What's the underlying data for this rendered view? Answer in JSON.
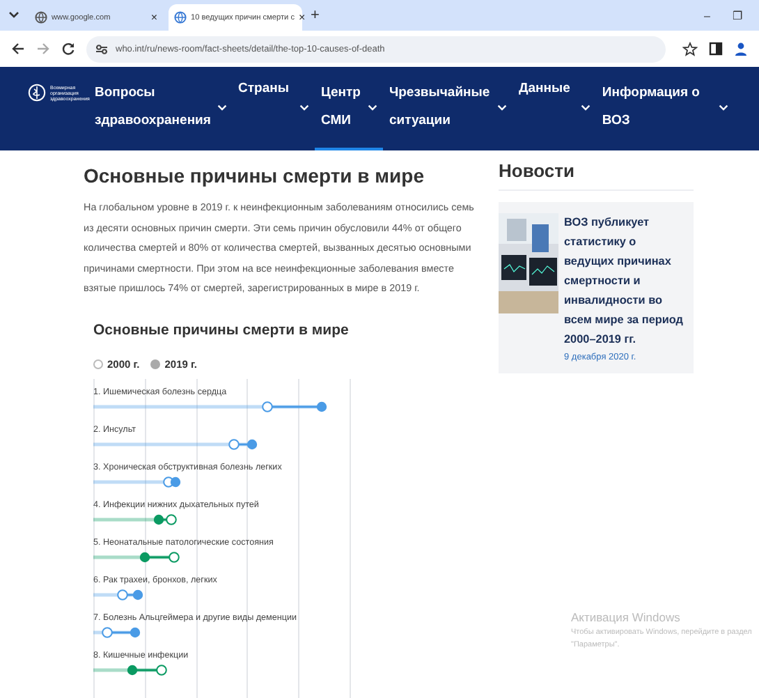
{
  "browser": {
    "tabs": [
      {
        "title": "www.google.com",
        "close": "×",
        "selected": false
      },
      {
        "title": "10 ведущих причин смерти с",
        "close": "×",
        "selected": true
      }
    ],
    "new_tab": "+",
    "address": "who.int/ru/news-room/fact-sheets/detail/the-top-10-causes-of-death",
    "window_controls": [
      "–",
      "❐"
    ]
  },
  "nav": {
    "logo_text": "Всемирная организация здравоохранения",
    "items": [
      {
        "label": "Вопросы здравоохранения",
        "selected": false
      },
      {
        "label": "Страны",
        "selected": false
      },
      {
        "label": "Центр СМИ",
        "selected": true
      },
      {
        "label": "Чрезвычайные ситуации",
        "selected": false
      },
      {
        "label": "Данные",
        "selected": false
      },
      {
        "label": "Информация о ВОЗ",
        "selected": false
      }
    ]
  },
  "article": {
    "title": "Основные причины смерти в мире",
    "paragraph": "На глобальном уровне в 2019 г. к неинфекционным заболеваниям относились семь из десяти основных причин смерти. Эти семь причин обусловили 44% от общего количества смертей и 80% от количества смертей, вызванных десятью основными причинами смертности. При этом на все неинфекционные заболевания вместе взятые пришлось 74% от смертей, зарегистрированных в мире в 2019 г.",
    "chart_title": "Основные причины смерти в мире",
    "years": [
      {
        "label": "2000 г.",
        "selected": false
      },
      {
        "label": "2019 г.",
        "selected": true
      }
    ],
    "causes": [
      {
        "label": "1. Ишемическая болезнь сердца",
        "color": "#4a9be6"
      },
      {
        "label": "2. Инсульт",
        "color": "#4a9be6"
      },
      {
        "label": "3. Хроническая обструктивная болезнь легких",
        "color": "#4a9be6"
      },
      {
        "label": "4. Инфекции нижних дыхательных путей",
        "color": "#0a9a62"
      },
      {
        "label": "5. Неонатальные патологические состояния",
        "color": "#0a9a62"
      },
      {
        "label": "6. Рак трахеи, бронхов, легких",
        "color": "#4a9be6"
      },
      {
        "label": "7. Болезнь Альцгеймера и другие виды деменции",
        "color": "#4a9be6"
      },
      {
        "label": "8. Кишечные инфекции",
        "color": "#0a9a62"
      }
    ]
  },
  "news": {
    "title": "Новости",
    "items": [
      {
        "headline": "ВОЗ публикует статистику о ведущих причинах смертности и инвалидности во всем мире за период 2000–2019 гг.",
        "date": "9 декабря 2020 г."
      }
    ]
  },
  "os_notice": {
    "title": "Активация Windows",
    "text": "Чтобы активировать Windows, перейдите в раздел \"Параметры\"."
  }
}
